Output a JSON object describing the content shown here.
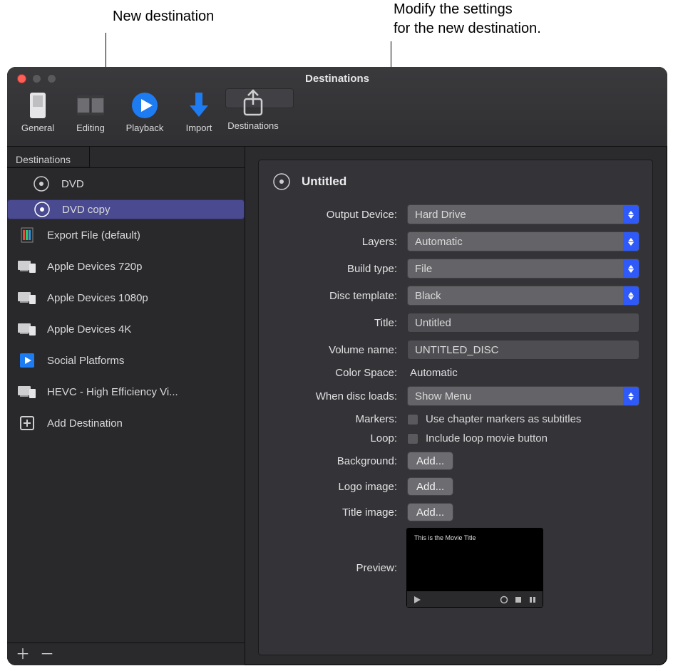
{
  "callouts": {
    "left": "New destination",
    "right": "Modify the settings\nfor the new destination."
  },
  "window": {
    "title": "Destinations"
  },
  "toolbar": [
    {
      "label": "General",
      "icon": "switch-icon"
    },
    {
      "label": "Editing",
      "icon": "filmstrip-icon"
    },
    {
      "label": "Playback",
      "icon": "play-icon"
    },
    {
      "label": "Import",
      "icon": "download-icon"
    },
    {
      "label": "Destinations",
      "icon": "share-up-icon",
      "selected": true
    }
  ],
  "sidebar": {
    "header": "Destinations",
    "items": [
      {
        "label": "DVD",
        "icon": "disc-icon",
        "indent": true
      },
      {
        "label": "DVD copy",
        "icon": "disc-icon",
        "indent": true,
        "selected": true
      },
      {
        "label": "Export File (default)",
        "icon": "file-color-icon"
      },
      {
        "label": "Apple Devices 720p",
        "icon": "devices-icon"
      },
      {
        "label": "Apple Devices 1080p",
        "icon": "devices-icon"
      },
      {
        "label": "Apple Devices 4K",
        "icon": "devices-icon"
      },
      {
        "label": "Social Platforms",
        "icon": "social-icon"
      },
      {
        "label": "HEVC - High Efficiency Vi...",
        "icon": "devices-icon"
      },
      {
        "label": "Add Destination",
        "icon": "plus-box-icon"
      }
    ]
  },
  "settings": {
    "title": "Untitled",
    "output_device_label": "Output Device:",
    "output_device": "Hard Drive",
    "layers_label": "Layers:",
    "layers": "Automatic",
    "build_type_label": "Build type:",
    "build_type": "File",
    "disc_template_label": "Disc template:",
    "disc_template": "Black",
    "title_label": "Title:",
    "volume_name_label": "Volume name:",
    "volume_name": "UNTITLED_DISC",
    "color_space_label": "Color Space:",
    "color_space": "Automatic",
    "when_disc_loads_label": "When disc loads:",
    "when_disc_loads": "Show Menu",
    "markers_label": "Markers:",
    "markers_text": "Use chapter markers as subtitles",
    "loop_label": "Loop:",
    "loop_text": "Include loop movie button",
    "background_label": "Background:",
    "background_button": "Add...",
    "logo_label": "Logo image:",
    "logo_button": "Add...",
    "title_image_label": "Title image:",
    "title_image_button": "Add...",
    "preview_label": "Preview:",
    "preview_title": "This is the Movie Title"
  }
}
